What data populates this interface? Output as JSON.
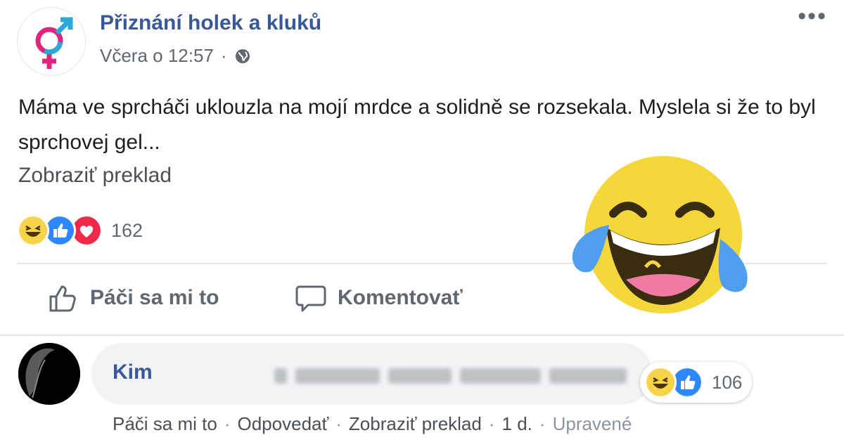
{
  "post": {
    "page_name": "Přiznání holek a kluků",
    "timestamp": "Včera o 12:57",
    "separator": "·",
    "privacy_icon": "globe-icon",
    "more_icon": "•••",
    "text": "Máma ve sprcháči uklouzla na mojí mrdce a solidně se rozsekala. Myslela si že to byl sprchovej gel...",
    "translate_link": "Zobraziť preklad",
    "reaction_icons": [
      "haha",
      "like",
      "love"
    ],
    "reaction_count": "162"
  },
  "actions": {
    "like": "Páči sa mi to",
    "comment": "Komentovať"
  },
  "comment": {
    "author": "Kim",
    "reaction_icons": [
      "haha",
      "like"
    ],
    "reaction_count": "106",
    "like": "Páči sa mi to",
    "reply": "Odpovedať",
    "translate": "Zobraziť preklad",
    "age": "1 d.",
    "edited": "Upravené",
    "separator": "·"
  },
  "colors": {
    "link_blue": "#385898",
    "gray_text": "#616770",
    "like_blue": "#2d88ff",
    "love_red": "#f0284a",
    "haha_yellow": "#f7d44a",
    "logo_pink": "#e0257a",
    "logo_blue": "#2aa8d8"
  }
}
